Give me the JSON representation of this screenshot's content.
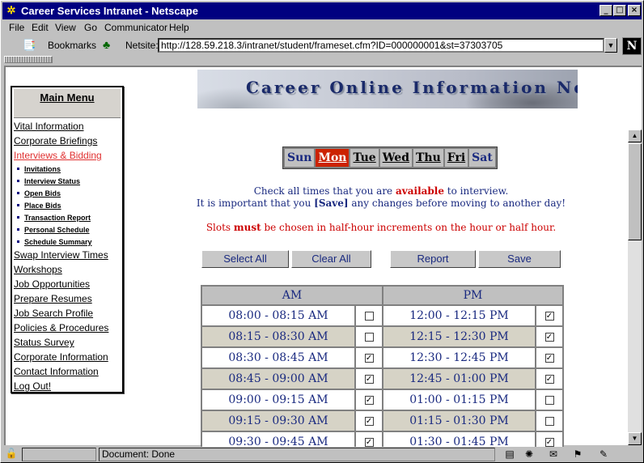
{
  "window": {
    "title": "Career Services Intranet - Netscape",
    "app_icon": "netscape-icon",
    "min_glyph": "_",
    "max_glyph": "□",
    "close_glyph": "×"
  },
  "menu": [
    "File",
    "Edit",
    "View",
    "Go",
    "Communicator",
    "Help"
  ],
  "toolbar": {
    "bookmarks_label": "Bookmarks",
    "netsite_label": "Netsite:",
    "url": "http://128.59.218.3/intranet/student/frameset.cfm?ID=000000001&st=37303705",
    "logo": "N"
  },
  "banner": {
    "title": "Career Online Information Network"
  },
  "main_menu": {
    "title": "Main Menu",
    "items": [
      {
        "label": "Vital Information"
      },
      {
        "label": "Corporate Briefings"
      },
      {
        "label": "Interviews & Bidding"
      },
      {
        "label": "Swap Interview Times"
      },
      {
        "label": "Workshops"
      },
      {
        "label": "Job Opportunities"
      },
      {
        "label": "Prepare Resumes"
      },
      {
        "label": "Job Search Profile"
      },
      {
        "label": "Policies & Procedures"
      },
      {
        "label": "Status Survey"
      },
      {
        "label": "Corporate Information"
      },
      {
        "label": "Contact Information"
      },
      {
        "label": "Log Out!"
      }
    ],
    "sub_items": [
      {
        "label": "Invitations"
      },
      {
        "label": "Interview Status"
      },
      {
        "label": "Open Bids"
      },
      {
        "label": "Place Bids"
      },
      {
        "label": "Transaction Report"
      },
      {
        "label": "Personal Schedule"
      },
      {
        "label": "Schedule Summary"
      }
    ]
  },
  "days": [
    "Sun",
    "Mon",
    "Tue",
    "Wed",
    "Thu",
    "Fri",
    "Sat"
  ],
  "selected_day": "Mon",
  "instructions": {
    "line1_pre": "Check all times that you are ",
    "line1_highlight": "available",
    "line1_post": " to interview.",
    "line2_pre": "It is important that you ",
    "line2_save": "[Save]",
    "line2_post": " any changes before moving to another day!",
    "line3_pre": "Slots ",
    "line3_must": "must",
    "line3_post": " be chosen in half-hour increments on the hour or half hour."
  },
  "buttons": {
    "select_all": "Select All",
    "clear_all": "Clear All",
    "report": "Report",
    "save": "Save"
  },
  "slots": {
    "am_header": "AM",
    "pm_header": "PM",
    "rows": [
      {
        "am": "08:00 - 08:15 AM",
        "am_checked": false,
        "pm": "12:00 - 12:15 PM",
        "pm_checked": true
      },
      {
        "am": "08:15 - 08:30 AM",
        "am_checked": false,
        "pm": "12:15 - 12:30 PM",
        "pm_checked": true
      },
      {
        "am": "08:30 - 08:45 AM",
        "am_checked": true,
        "pm": "12:30 - 12:45 PM",
        "pm_checked": true
      },
      {
        "am": "08:45 - 09:00 AM",
        "am_checked": true,
        "pm": "12:45 - 01:00 PM",
        "pm_checked": true
      },
      {
        "am": "09:00 - 09:15 AM",
        "am_checked": true,
        "pm": "01:00 - 01:15 PM",
        "pm_checked": false
      },
      {
        "am": "09:15 - 09:30 AM",
        "am_checked": true,
        "pm": "01:15 - 01:30 PM",
        "pm_checked": false
      },
      {
        "am": "09:30 - 09:45 AM",
        "am_checked": true,
        "pm": "01:30 - 01:45 PM",
        "pm_checked": true
      }
    ]
  },
  "status": {
    "text": "Document: Done"
  }
}
